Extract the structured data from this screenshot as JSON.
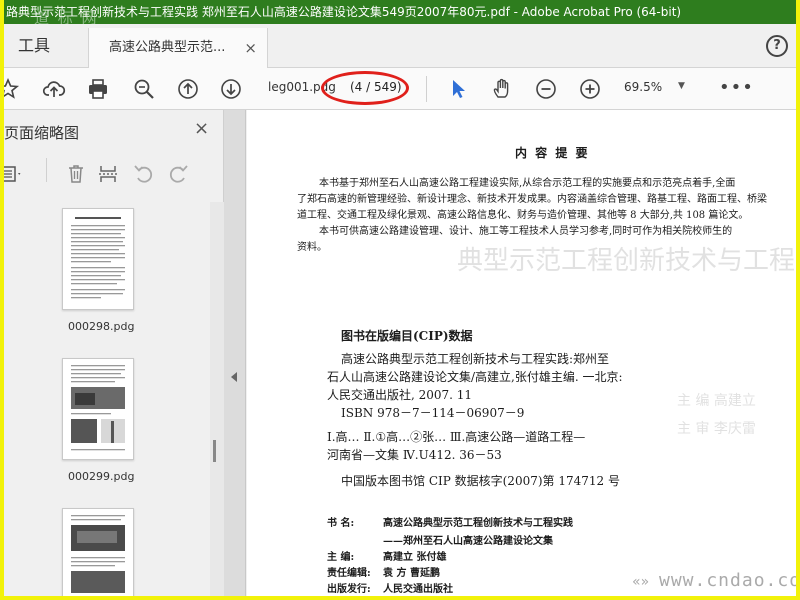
{
  "window": {
    "title": "路典型示范工程创新技术与工程实践 郑州至石人山高速公路建设论文集549页2007年80元.pdf - Adobe Acrobat Pro (64-bit)",
    "title_watermark": "道 标 网"
  },
  "tabs": {
    "tools_label": "工具",
    "document_label": "高速公路典型示范...",
    "close_glyph": "×",
    "help_glyph": "?"
  },
  "toolbar": {
    "page_field_value": "leg001.pdg",
    "page_count": "(4 / 549)",
    "zoom_value": "69.5%",
    "zoom_caret": "▼",
    "more_glyph": "•••",
    "icons": [
      "star-icon",
      "upload-icon",
      "print-icon",
      "zoom-search-icon",
      "page-up-icon",
      "page-down-icon",
      "select-cursor-icon",
      "hand-icon",
      "zoom-out-icon",
      "zoom-in-icon",
      "more-icon"
    ],
    "highlight_color": "#e0201b"
  },
  "left_panel": {
    "title": "页面缩略图",
    "close_glyph": "×",
    "thumbnails": [
      {
        "label": "000298.pdg"
      },
      {
        "label": "000299.pdg"
      },
      {
        "label": ""
      }
    ]
  },
  "document": {
    "heading": "内 容 提 要",
    "summary_lines": [
      "本书基于郑州至石人山高速公路工程建设实际,从综合示范工程的实施要点和示范亮点着手,全面",
      "了郑石高速的新管理经验、新设计理念、新技术开发成果。内容涵盖综合管理、路基工程、路面工程、桥梁",
      "道工程、交通工程及绿化景观、高速公路信息化、财务与造价管理、其他等 8 大部分,共 108 篇论文。",
      "本书可供高速公路建设管理、设计、施工等工程技术人员学习参考,同时可作为相关院校师生的",
      "资料。"
    ],
    "cip_title": "图书在版编目(CIP)数据",
    "cip_lines": [
      "高速公路典型示范工程创新技术与工程实践:郑州至",
      "石人山高速公路建设论文集/高建立,张付雄主编. 一北京:",
      "人民交通出版社, 2007. 11",
      "ISBN 978－7－114－06907－9"
    ],
    "classification_lines": [
      "Ⅰ.高… Ⅱ.①高…②张… Ⅲ.高速公路—道路工程—",
      "河南省—文集 Ⅳ.U412. 36－53"
    ],
    "cip_number": "中国版本图书馆 CIP 数据核字(2007)第 174712 号",
    "colophon": [
      {
        "key": "书 名:",
        "value": "高速公路典型示范工程创新技术与工程实践"
      },
      {
        "key": "",
        "value": "——郑州至石人山高速公路建设论文集"
      },
      {
        "key": "主 编:",
        "value": "高建立 张付雄"
      },
      {
        "key": "责任编辑:",
        "value": "袁 方 曹延鹏"
      },
      {
        "key": "出版发行:",
        "value": "人民交通出版社"
      }
    ],
    "ghost_text": [
      "典型示范工程创新技术与工程实践",
      "主 编 高建立",
      "主 审 李庆雷"
    ]
  },
  "watermark": {
    "corner": "www.cndao.com",
    "fish": "«»"
  }
}
